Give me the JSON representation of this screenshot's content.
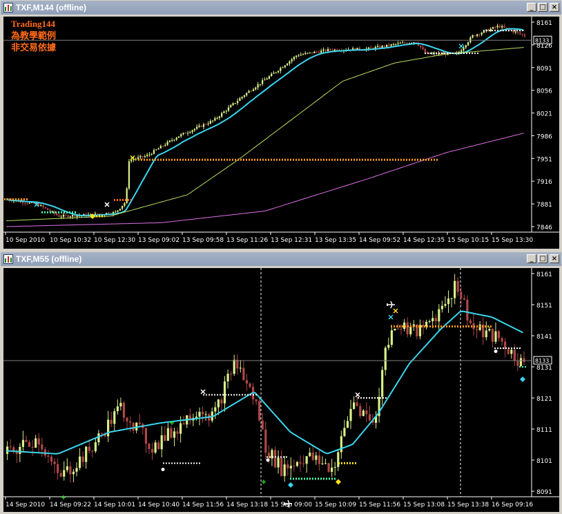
{
  "window1": {
    "title": "TXF,M144 (offline)",
    "buttons": {
      "minimize": "_",
      "maximize": "□",
      "close": "×"
    },
    "overlay_lines": [
      "Trading144",
      "為教學範例",
      "非交易依據"
    ],
    "price_ticks": [
      "8161",
      "8126",
      "8091",
      "8056",
      "8021",
      "7986",
      "7951",
      "7916",
      "7881",
      "7846"
    ],
    "current_price": "8133",
    "time_labels": [
      "10 Sep 2010",
      "10 Sep 10:32",
      "10 Sep 12:30",
      "13 Sep 09:02",
      "13 Sep 09:58",
      "13 Sep 11:26",
      "13 Sep 12:31",
      "13 Sep 13:35",
      "14 Sep 09:52",
      "14 Sep 12:35",
      "15 Sep 10:15",
      "15 Sep 13:30"
    ]
  },
  "window2": {
    "title": "TXF,M55 (offline)",
    "buttons": {
      "minimize": "_",
      "maximize": "□",
      "close": "×"
    },
    "price_ticks": [
      "8161",
      "8151",
      "8141",
      "8131",
      "8121",
      "8111",
      "8101",
      "8091"
    ],
    "current_price": "8133",
    "time_labels": [
      "14 Sep 2010",
      "14 Sep 09:22",
      "14 Sep 10:01",
      "14 Sep 10:40",
      "14 Sep 11:56",
      "14 Sep 13:18",
      "15 Sep 09:00",
      "15 Sep 10:09",
      "15 Sep 11:56",
      "15 Sep 13:08",
      "15 Sep 13:38",
      "16 Sep 09:16"
    ]
  },
  "colors": {
    "bull_candle": "#d8f08a",
    "bear_candle": "#b04848",
    "fast_ma": "#3ad6ef",
    "mid_ma": "#b8e060",
    "slow_ma": "#e070e8",
    "orange_level": "#ff9a1a",
    "text_orange": "#ff6a1a"
  }
}
